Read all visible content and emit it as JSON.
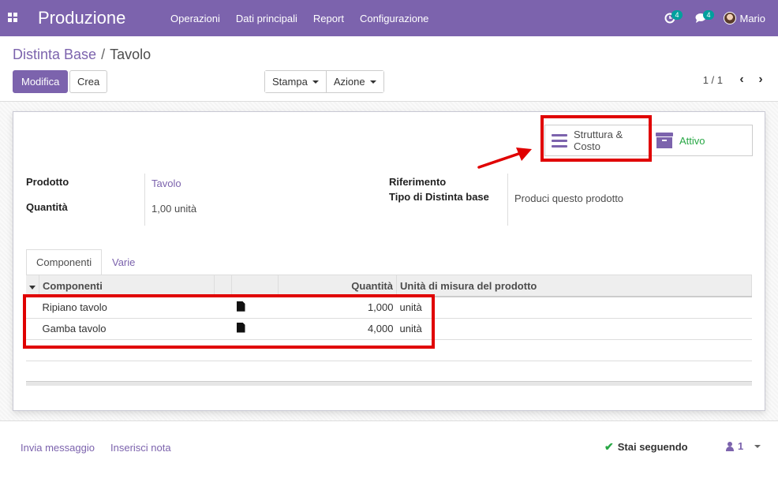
{
  "navbar": {
    "app_title": "Produzione",
    "menu": [
      "Operazioni",
      "Dati principali",
      "Report",
      "Configurazione"
    ],
    "activity_count": "4",
    "messages_count": "4",
    "user_name": "Mario",
    "color": "#7c63ad"
  },
  "breadcrumb": {
    "parent": "Distinta Base",
    "separator": "/",
    "current": "Tavolo"
  },
  "actions": {
    "edit_label": "Modifica",
    "create_label": "Crea",
    "print_label": "Stampa",
    "action_label": "Azione"
  },
  "pager": {
    "value": "1 / 1"
  },
  "button_box": {
    "structure_label": "Struttura & Costo",
    "active_label": "Attivo"
  },
  "form": {
    "product_label": "Prodotto",
    "product_value": "Tavolo",
    "quantity_label": "Quantità",
    "quantity_value": "1,00",
    "quantity_uom": "unità",
    "reference_label": "Riferimento",
    "reference_value": "",
    "bom_type_label": "Tipo di Distinta base",
    "bom_type_value": "Produci questo prodotto"
  },
  "tabs": [
    {
      "label": "Componenti",
      "active": true
    },
    {
      "label": "Varie",
      "active": false
    }
  ],
  "table": {
    "headers": {
      "component": "Componenti",
      "quantity": "Quantità",
      "uom": "Unità di misura del prodotto"
    },
    "rows": [
      {
        "component": "Ripiano tavolo",
        "quantity": "1,000",
        "uom": "unità"
      },
      {
        "component": "Gamba tavolo",
        "quantity": "4,000",
        "uom": "unità"
      }
    ]
  },
  "chatter": {
    "send_message": "Invia messaggio",
    "log_note": "Inserisci nota",
    "following": "Stai seguendo",
    "followers_count": "1"
  },
  "annotation_color": "#e00000"
}
